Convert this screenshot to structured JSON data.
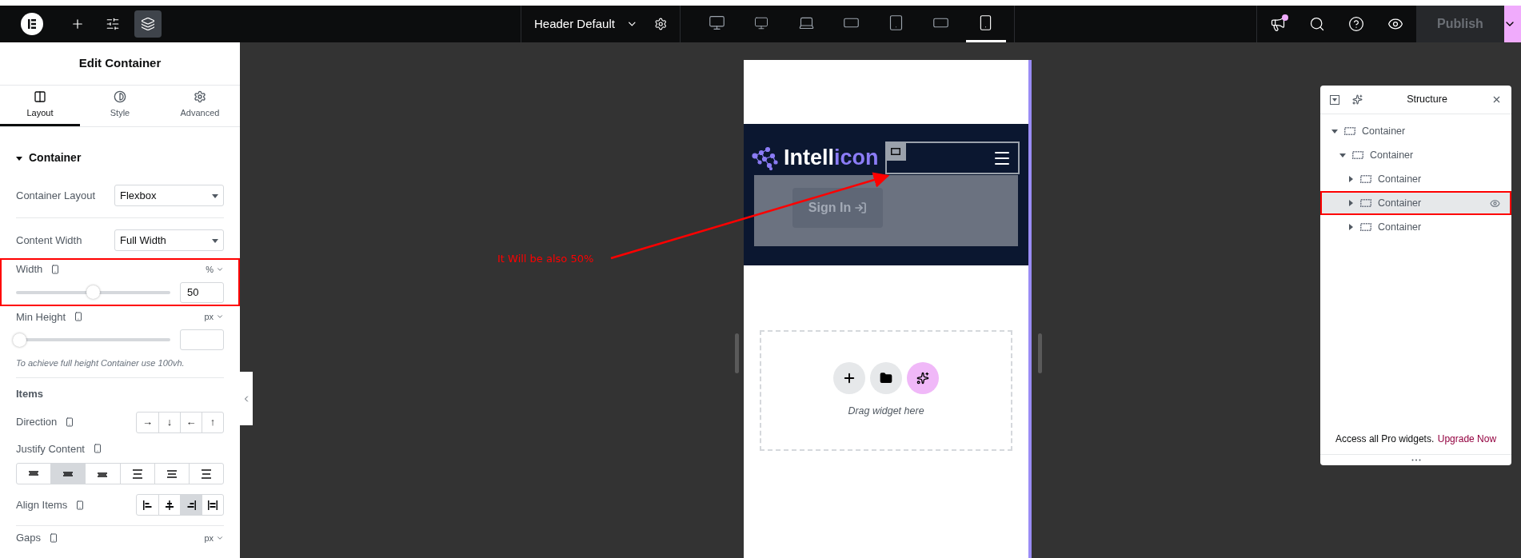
{
  "topbar": {
    "tools": [
      {
        "selected": false
      },
      {
        "selected": false
      },
      {
        "selected": true
      }
    ],
    "document": {
      "title": "Header Default"
    },
    "devices": [
      {
        "selected": false
      },
      {
        "selected": false
      },
      {
        "selected": false
      },
      {
        "selected": false
      },
      {
        "selected": false
      },
      {
        "selected": false
      },
      {
        "selected": true
      }
    ],
    "notifications": {
      "unread": true
    },
    "publish": {
      "label": "Publish",
      "disabled": true
    }
  },
  "panel": {
    "title": "Edit Container",
    "tabs": [
      {
        "label": "Layout",
        "selected": true
      },
      {
        "label": "Style",
        "selected": false
      },
      {
        "label": "Advanced",
        "selected": false
      }
    ],
    "section": {
      "title": "Container",
      "expanded": true
    },
    "controls": [
      {
        "kind": "select",
        "label": "Container Layout",
        "value": "Flexbox"
      },
      {
        "kind": "divider"
      },
      {
        "kind": "select",
        "label": "Content Width",
        "value": "Full Width"
      },
      {
        "kind": "slider",
        "label": "Width",
        "unit": "%",
        "level": 0.5,
        "value": "50",
        "highlighted": true
      },
      {
        "kind": "slider",
        "label": "Min Height",
        "unit": "px",
        "level": 0,
        "highlighted": false
      },
      {
        "kind": "hint",
        "text": "To achieve full height Container use 100vh."
      },
      {
        "kind": "divider"
      },
      {
        "kind": "heading",
        "label": "Items"
      },
      {
        "kind": "choices",
        "label": "Direction",
        "options": [
          {
            "glyph": "→",
            "selected": false
          },
          {
            "glyph": "↓",
            "selected": false
          },
          {
            "glyph": "←",
            "selected": false
          },
          {
            "glyph": "↑",
            "selected": false
          }
        ]
      },
      {
        "kind": "bar",
        "label": "Justify Content",
        "options": [
          {
            "selected": false
          },
          {
            "selected": true
          },
          {
            "selected": false
          },
          {
            "selected": false
          },
          {
            "selected": false
          },
          {
            "selected": false
          }
        ]
      },
      {
        "kind": "align",
        "label": "Align Items",
        "options": [
          {
            "selected": false
          },
          {
            "selected": false
          },
          {
            "selected": true
          },
          {
            "selected": false
          }
        ]
      },
      {
        "kind": "divider"
      },
      {
        "kind": "unit",
        "label": "Gaps",
        "unit": "px"
      }
    ]
  },
  "preview": {
    "brand": [
      "Intell",
      "icon"
    ],
    "sign_in": "Sign In",
    "dropzone": "Drag widget here"
  },
  "annotation": {
    "text": "It Will be also 50%"
  },
  "structure": {
    "title": "Structure",
    "tree": [
      {
        "label": "Container",
        "expanded": true,
        "selected": false,
        "highlighted": false,
        "children": [
          {
            "label": "Container",
            "expanded": true,
            "selected": false,
            "highlighted": false,
            "children": [
              {
                "label": "Container",
                "expanded": false,
                "selected": false,
                "highlighted": false
              },
              {
                "label": "Container",
                "expanded": false,
                "selected": true,
                "highlighted": true
              },
              {
                "label": "Container",
                "expanded": false,
                "selected": false,
                "highlighted": false
              }
            ]
          }
        ]
      }
    ],
    "footer": {
      "text": "Access all Pro widgets.",
      "link": "Upgrade Now"
    }
  }
}
